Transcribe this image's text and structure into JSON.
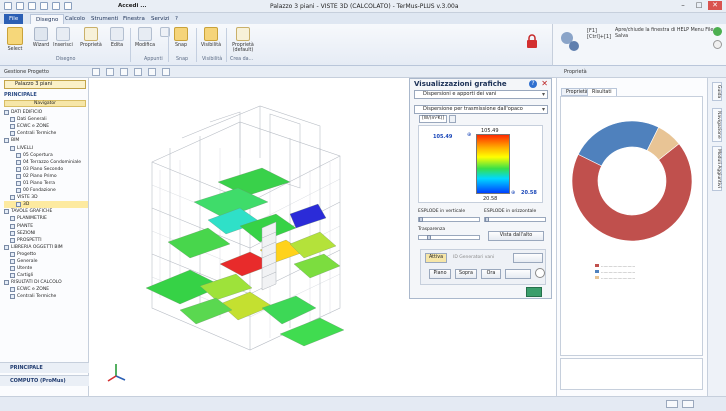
{
  "app": {
    "title": "Palazzo 3 piani - VISTE 3D (CALCOLATO) - TerMus-PLUS v.3.00a",
    "qat_accedi": "Accedi ..."
  },
  "ribbon": {
    "tabs": [
      "File",
      "Disegno",
      "Calcolo",
      "Strumenti",
      "Finestra",
      "Servizi",
      "?"
    ],
    "active_tab": "Disegno",
    "buttons": {
      "select": "Select",
      "wizard": "Wizard",
      "inserisci": "Inserisci",
      "proprieta": "Proprietà",
      "edita": "Edita",
      "modifica": "Modifica",
      "appunti": "Appunti",
      "snap": "Snap",
      "visibilita": "Visibilità",
      "proprieta_default": "Proprietà (default)"
    },
    "groups": {
      "disegno": "Disegno",
      "appunti": "Appunti",
      "snap": "Snap",
      "visibilita": "Visibilità",
      "crea_da": "Crea da..."
    },
    "help": {
      "keys": "[F1] [Ctrl]+[1]",
      "text": "Apre/chiude la finestra di HELP Menu File: Salva"
    }
  },
  "left_panel": {
    "header": "Gestione Progetto",
    "project": "Palazzo 3 piani",
    "section": "PRINCIPALE",
    "navigator": "Navigator",
    "tree": [
      {
        "label": "DATI EDIFICIO",
        "level": 0
      },
      {
        "label": "Dati Generali",
        "level": 1
      },
      {
        "label": "ECWC e ZONE",
        "level": 1
      },
      {
        "label": "Centrali Termiche",
        "level": 1
      },
      {
        "label": "BIM",
        "level": 0
      },
      {
        "label": "LIVELLI",
        "level": 1
      },
      {
        "label": "05 Copertura",
        "level": 2
      },
      {
        "label": "04 Terrazzo Condominiale",
        "level": 2
      },
      {
        "label": "03 Piano Secondo",
        "level": 2
      },
      {
        "label": "02 Piano Primo",
        "level": 2
      },
      {
        "label": "01 Piano Terra",
        "level": 2
      },
      {
        "label": "00 Fondazione",
        "level": 2
      },
      {
        "label": "VISTE 3D",
        "level": 1
      },
      {
        "label": "3D",
        "level": 2,
        "selected": true
      },
      {
        "label": "TAVOLE GRAFICHE",
        "level": 0
      },
      {
        "label": "PLANIMETRIE",
        "level": 1
      },
      {
        "label": "PIANTE",
        "level": 1
      },
      {
        "label": "SEZIONI",
        "level": 1
      },
      {
        "label": "PROSPETTI",
        "level": 1
      },
      {
        "label": "LIBRERIA OGGETTI BIM",
        "level": 0
      },
      {
        "label": "Progetto",
        "level": 1
      },
      {
        "label": "Generale",
        "level": 1
      },
      {
        "label": "Utente",
        "level": 1
      },
      {
        "label": "Cartigli",
        "level": 1
      },
      {
        "label": "RISULTATI DI CALCOLO",
        "level": 0
      },
      {
        "label": "ECWC e ZONE",
        "level": 1
      },
      {
        "label": "Centrali Termiche",
        "level": 1
      }
    ],
    "footer_1": "PRINCIPALE",
    "footer_2": "COMPUTO (ProMus)"
  },
  "vis_panel": {
    "title": "Visualizzazioni grafiche",
    "dropdown_1": "Dispersioni e apporti dei vani",
    "dropdown_2": "Dispersione per trasmissione dall'opaco",
    "unit": "[W/(m²K)]",
    "max_label": "105.49",
    "max_value": "105.49",
    "min_value": "20.58",
    "min_label": "20.58",
    "explode_v": "ESPLODE in verticale",
    "explode_h": "ESPLODE in orizzontale",
    "transparency": "Trasparenza",
    "view_from_top": "Vista dall'alto",
    "active_btn": "Attiva",
    "locale_label": "ID Generatori vani",
    "btn_piano": "Piano",
    "btn_sopra": "Sopra",
    "btn_ora": "Ora"
  },
  "right_panel": {
    "header": "Proprietà",
    "tabs": [
      "Proprietà",
      "Risultati"
    ],
    "active_tab": "Risultati"
  },
  "side_tabs": [
    "Guida",
    "Navigazione",
    "Moduli Aggiuntivi"
  ],
  "colors": {
    "accent": "#2b5fb4",
    "donut_red": "#c0504d",
    "donut_blue": "#4f81bd",
    "donut_tan": "#e8c495"
  },
  "chart_data": {
    "type": "pie",
    "donut": true,
    "values": [
      68,
      25,
      7
    ],
    "colors": [
      "#c0504d",
      "#4f81bd",
      "#e8c495"
    ]
  }
}
